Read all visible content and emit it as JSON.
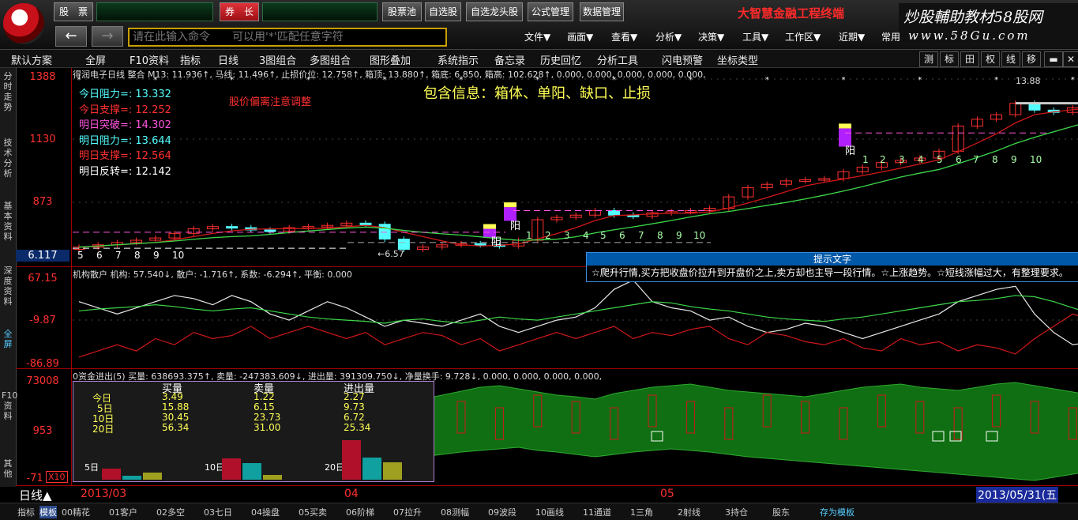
{
  "colors": {
    "up": "#ff3030",
    "down": "#54ffff",
    "ma1": "#d01818",
    "ma2": "#3cd84a",
    "pink_dash": "#ff55dd",
    "yellow": "#ffff55",
    "green_fill": "#0f6f12",
    "tip_blue": "#0058a8"
  },
  "topbar": {
    "buttons": [
      "股　票",
      "券　长",
      "股票池",
      "自选股",
      "自选龙头股",
      "公式管理",
      "数据管理"
    ],
    "brand": "大智慧金融工程终端",
    "watermark_line1": "炒股輔助教材58股网",
    "watermark_line2": "www.58Gu.com",
    "command_placeholder": "请在此输入命令　　可以用'*'匹配任意字符",
    "back_icon": "arrow-left-icon",
    "forward_icon": "arrow-right-icon",
    "menus": [
      "文件▼",
      "画面▼",
      "查看▼",
      "分析▼",
      "决策▼",
      "工具▼",
      "工作区▼",
      "近期▼",
      "常用"
    ]
  },
  "toolbar2": {
    "items": [
      "默认方案",
      "全屏",
      "F10资料",
      "指标",
      "日线",
      "3图组合",
      "多图组合",
      "图形叠加",
      "系统指示",
      "备忘录",
      "历史回忆",
      "分析工具",
      "闪电预警",
      "坐标类型"
    ],
    "right": [
      "测",
      "标",
      "田",
      "权",
      "线",
      "移"
    ]
  },
  "vtabs": [
    "分时走势",
    "技术分析",
    "基本资料",
    "深度资料",
    "全屏",
    "F10资料",
    "其他"
  ],
  "price_panel": {
    "header": "得润电子日线 整合 M13: 11.936↑, 马线: 11.496↑, 止损价位: 12.758↑, 箱顶: 13.880↑, 箱底: 6.850, 箱高: 102.628↑, 0.000, 0.000, 0.000, 0.000, 0.000,",
    "y_labels": [
      "1388",
      "1130",
      "873",
      "6.117"
    ],
    "info_lines": [
      {
        "text": "今日阻力=: 13.332",
        "color": "#54ffff"
      },
      {
        "text": "今日支撑=: 12.252",
        "color": "#ff3030"
      },
      {
        "text": "明日突破=: 14.302",
        "color": "#ff55dd"
      },
      {
        "text": "明日阻力=: 13.644",
        "color": "#54ffff"
      },
      {
        "text": "明日支撑=: 12.564",
        "color": "#ff3030"
      },
      {
        "text": "明日反转=: 12.142",
        "color": "#ffffff"
      }
    ],
    "warning": "股价偏离注意调整",
    "info_title": "包含信息：箱体、单阳、缺口、止损",
    "low_mark": "←6.57",
    "high_mark": "13.88",
    "yang_label": "阳",
    "count_labels": [
      "5",
      "6",
      "7",
      "8",
      "9",
      "10",
      "1",
      "2",
      "3",
      "4",
      "5",
      "6",
      "7",
      "8",
      "9",
      "10",
      "1",
      "2",
      "3",
      "4",
      "5",
      "6",
      "7",
      "8",
      "9",
      "10"
    ]
  },
  "tip_box": {
    "title": "提示文字",
    "text": "☆爬升行情,买方把收盘价拉升到开盘价之上,卖方却也主导一段行情。☆上涨趋势。☆短线涨幅过大，有整理要求。"
  },
  "panel2": {
    "header": "机构散户 机构: 57.540↓, 散户: -1.716↑, 系数: -6.294↑, 平衡: 0.000",
    "y_labels": [
      "67.15",
      "-9.87",
      "-86.89"
    ]
  },
  "panel3": {
    "header": "0资金进出(5) 买量: 638693.375↑, 卖量: -247383.609↓, 进出量: 391309.750↓, 净量换手: 9.728↓, 0.000, 0.000, 0.000, 0.000,",
    "y_labels": [
      "73008",
      "953",
      "-71",
      "X10"
    ],
    "table_headers": [
      "买量",
      "卖量",
      "进出量"
    ],
    "rows": [
      {
        "label": "今日",
        "values": [
          "3.49",
          "1.22",
          "2.27"
        ]
      },
      {
        "label": "5日",
        "values": [
          "15.88",
          "6.15",
          "9.73"
        ]
      },
      {
        "label": "10日",
        "values": [
          "30.45",
          "23.73",
          "6.72"
        ]
      },
      {
        "label": "20日",
        "values": [
          "56.34",
          "31.00",
          "25.34"
        ]
      }
    ],
    "bar_groups": [
      {
        "label": "5日",
        "values": [
          15.88,
          6.15,
          9.73
        ]
      },
      {
        "label": "10日",
        "values": [
          30.45,
          23.73,
          6.72
        ]
      },
      {
        "label": "20日",
        "values": [
          56.34,
          31.0,
          25.34
        ]
      }
    ]
  },
  "status": {
    "period": "日线▲",
    "dates": [
      "2013/03",
      "04",
      "05"
    ],
    "current_date": "2013/05/31(五"
  },
  "bottom_tabs": [
    "指标",
    "模板",
    "00精花",
    "01客户",
    "02多空",
    "03七日",
    "04操盘",
    "05买卖",
    "06阶梯",
    "07拉升",
    "08测幅",
    "09波段",
    "10画线",
    "11通道",
    "1三角",
    "2射线",
    "3持仓",
    "股东",
    "存为模板"
  ]
}
